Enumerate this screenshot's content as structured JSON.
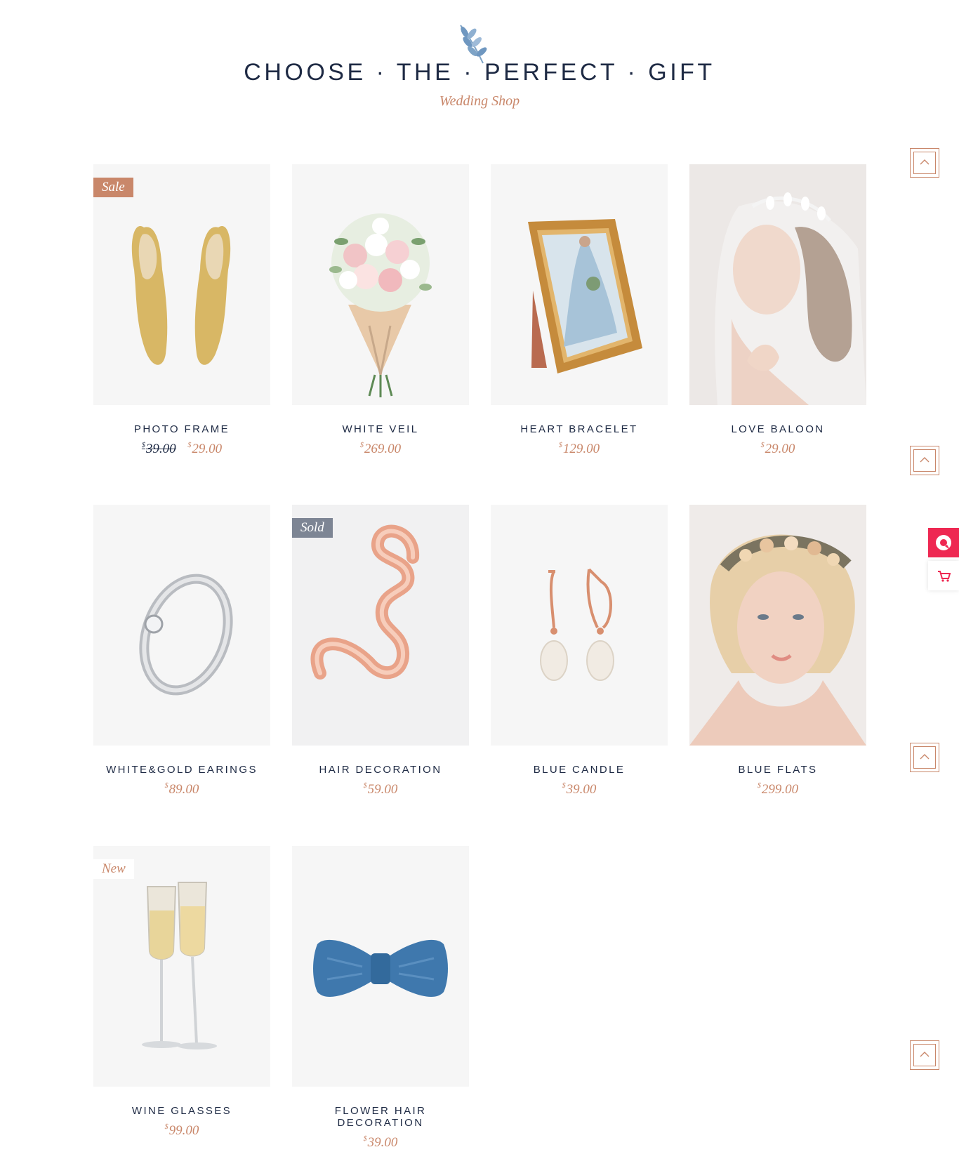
{
  "header": {
    "title": "CHOOSE · THE · PERFECT · GIFT",
    "subtitle": "Wedding Shop"
  },
  "colors": {
    "accent": "#c9876a",
    "text": "#1e2a44",
    "tile_background": "#f6f6f6",
    "sold_badge": "#7d8594",
    "side_button": "#ee2852"
  },
  "products": [
    {
      "name": "PHOTO FRAME",
      "old_currency": "$",
      "old_price": "39.00",
      "currency": "$",
      "price": "29.00",
      "badge": "Sale",
      "image": "gold-pointed-shoes"
    },
    {
      "name": "WHITE VEIL",
      "currency": "$",
      "price": "269.00",
      "image": "flower-bouquet"
    },
    {
      "name": "HEART BRACELET",
      "currency": "$",
      "price": "129.00",
      "image": "gold-photo-frame"
    },
    {
      "name": "LOVE BALOON",
      "currency": "$",
      "price": "29.00",
      "image": "bride-with-veil"
    },
    {
      "name": "WHITE&GOLD EARINGS",
      "currency": "$",
      "price": "89.00",
      "image": "silver-ring"
    },
    {
      "name": "HAIR DECORATION",
      "currency": "$",
      "price": "59.00",
      "badge": "Sold",
      "image": "love-balloon"
    },
    {
      "name": "BLUE CANDLE",
      "currency": "$",
      "price": "39.00",
      "image": "pearl-earrings"
    },
    {
      "name": "BLUE FLATS",
      "currency": "$",
      "price": "299.00",
      "image": "bride-with-floral-headband"
    },
    {
      "name": "WINE GLASSES",
      "currency": "$",
      "price": "99.00",
      "badge": "New",
      "image": "champagne-glasses"
    },
    {
      "name": "FLOWER HAIR DECORATION",
      "currency": "$",
      "price": "39.00",
      "image": "blue-bow-tie"
    }
  ],
  "icons": {
    "scroll_top": "chevron-up-icon",
    "side_primary": "chat-bubble-icon",
    "side_secondary": "cart-icon"
  }
}
